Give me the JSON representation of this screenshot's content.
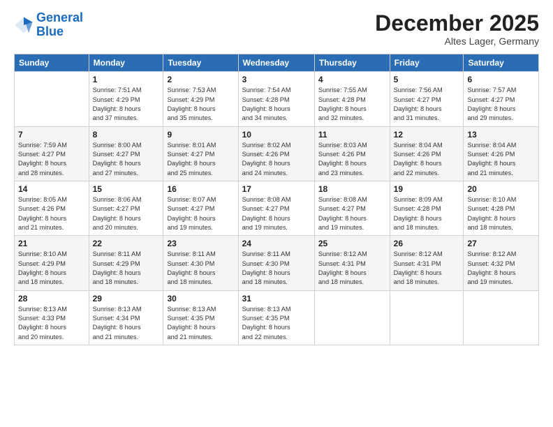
{
  "logo": {
    "line1": "General",
    "line2": "Blue"
  },
  "header": {
    "month": "December 2025",
    "location": "Altes Lager, Germany"
  },
  "days_of_week": [
    "Sunday",
    "Monday",
    "Tuesday",
    "Wednesday",
    "Thursday",
    "Friday",
    "Saturday"
  ],
  "weeks": [
    [
      {
        "day": "",
        "info": ""
      },
      {
        "day": "1",
        "info": "Sunrise: 7:51 AM\nSunset: 4:29 PM\nDaylight: 8 hours\nand 37 minutes."
      },
      {
        "day": "2",
        "info": "Sunrise: 7:53 AM\nSunset: 4:29 PM\nDaylight: 8 hours\nand 35 minutes."
      },
      {
        "day": "3",
        "info": "Sunrise: 7:54 AM\nSunset: 4:28 PM\nDaylight: 8 hours\nand 34 minutes."
      },
      {
        "day": "4",
        "info": "Sunrise: 7:55 AM\nSunset: 4:28 PM\nDaylight: 8 hours\nand 32 minutes."
      },
      {
        "day": "5",
        "info": "Sunrise: 7:56 AM\nSunset: 4:27 PM\nDaylight: 8 hours\nand 31 minutes."
      },
      {
        "day": "6",
        "info": "Sunrise: 7:57 AM\nSunset: 4:27 PM\nDaylight: 8 hours\nand 29 minutes."
      }
    ],
    [
      {
        "day": "7",
        "info": "Sunrise: 7:59 AM\nSunset: 4:27 PM\nDaylight: 8 hours\nand 28 minutes."
      },
      {
        "day": "8",
        "info": "Sunrise: 8:00 AM\nSunset: 4:27 PM\nDaylight: 8 hours\nand 27 minutes."
      },
      {
        "day": "9",
        "info": "Sunrise: 8:01 AM\nSunset: 4:27 PM\nDaylight: 8 hours\nand 25 minutes."
      },
      {
        "day": "10",
        "info": "Sunrise: 8:02 AM\nSunset: 4:26 PM\nDaylight: 8 hours\nand 24 minutes."
      },
      {
        "day": "11",
        "info": "Sunrise: 8:03 AM\nSunset: 4:26 PM\nDaylight: 8 hours\nand 23 minutes."
      },
      {
        "day": "12",
        "info": "Sunrise: 8:04 AM\nSunset: 4:26 PM\nDaylight: 8 hours\nand 22 minutes."
      },
      {
        "day": "13",
        "info": "Sunrise: 8:04 AM\nSunset: 4:26 PM\nDaylight: 8 hours\nand 21 minutes."
      }
    ],
    [
      {
        "day": "14",
        "info": "Sunrise: 8:05 AM\nSunset: 4:26 PM\nDaylight: 8 hours\nand 21 minutes."
      },
      {
        "day": "15",
        "info": "Sunrise: 8:06 AM\nSunset: 4:27 PM\nDaylight: 8 hours\nand 20 minutes."
      },
      {
        "day": "16",
        "info": "Sunrise: 8:07 AM\nSunset: 4:27 PM\nDaylight: 8 hours\nand 19 minutes."
      },
      {
        "day": "17",
        "info": "Sunrise: 8:08 AM\nSunset: 4:27 PM\nDaylight: 8 hours\nand 19 minutes."
      },
      {
        "day": "18",
        "info": "Sunrise: 8:08 AM\nSunset: 4:27 PM\nDaylight: 8 hours\nand 19 minutes."
      },
      {
        "day": "19",
        "info": "Sunrise: 8:09 AM\nSunset: 4:28 PM\nDaylight: 8 hours\nand 18 minutes."
      },
      {
        "day": "20",
        "info": "Sunrise: 8:10 AM\nSunset: 4:28 PM\nDaylight: 8 hours\nand 18 minutes."
      }
    ],
    [
      {
        "day": "21",
        "info": "Sunrise: 8:10 AM\nSunset: 4:29 PM\nDaylight: 8 hours\nand 18 minutes."
      },
      {
        "day": "22",
        "info": "Sunrise: 8:11 AM\nSunset: 4:29 PM\nDaylight: 8 hours\nand 18 minutes."
      },
      {
        "day": "23",
        "info": "Sunrise: 8:11 AM\nSunset: 4:30 PM\nDaylight: 8 hours\nand 18 minutes."
      },
      {
        "day": "24",
        "info": "Sunrise: 8:11 AM\nSunset: 4:30 PM\nDaylight: 8 hours\nand 18 minutes."
      },
      {
        "day": "25",
        "info": "Sunrise: 8:12 AM\nSunset: 4:31 PM\nDaylight: 8 hours\nand 18 minutes."
      },
      {
        "day": "26",
        "info": "Sunrise: 8:12 AM\nSunset: 4:31 PM\nDaylight: 8 hours\nand 18 minutes."
      },
      {
        "day": "27",
        "info": "Sunrise: 8:12 AM\nSunset: 4:32 PM\nDaylight: 8 hours\nand 19 minutes."
      }
    ],
    [
      {
        "day": "28",
        "info": "Sunrise: 8:13 AM\nSunset: 4:33 PM\nDaylight: 8 hours\nand 20 minutes."
      },
      {
        "day": "29",
        "info": "Sunrise: 8:13 AM\nSunset: 4:34 PM\nDaylight: 8 hours\nand 21 minutes."
      },
      {
        "day": "30",
        "info": "Sunrise: 8:13 AM\nSunset: 4:35 PM\nDaylight: 8 hours\nand 21 minutes."
      },
      {
        "day": "31",
        "info": "Sunrise: 8:13 AM\nSunset: 4:35 PM\nDaylight: 8 hours\nand 22 minutes."
      },
      {
        "day": "",
        "info": ""
      },
      {
        "day": "",
        "info": ""
      },
      {
        "day": "",
        "info": ""
      }
    ]
  ]
}
